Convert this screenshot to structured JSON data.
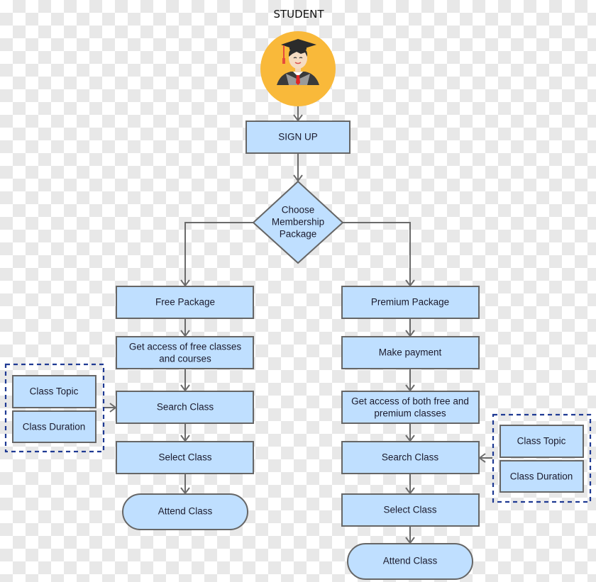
{
  "title": "STUDENT",
  "avatar": {
    "icon": "graduate-student-icon",
    "circle_color": "#F9B93A"
  },
  "colors": {
    "node_fill": "#BFDFFF",
    "node_border": "#666666",
    "edge": "#6B6B6B",
    "group_border": "#1F3A93"
  },
  "nodes": {
    "sign_up": "SIGN UP",
    "decision": [
      "Choose",
      "Membership",
      "Package"
    ],
    "free": {
      "package": "Free Package",
      "access": [
        "Get access of free classes",
        "and courses"
      ],
      "search": "Search Class",
      "select": "Select Class",
      "attend": "Attend Class",
      "filters": [
        "Class Topic",
        "Class Duration"
      ]
    },
    "premium": {
      "package": "Premium Package",
      "payment": "Make payment",
      "access": [
        "Get access of both free and",
        "premium classes"
      ],
      "search": "Search Class",
      "select": "Select Class",
      "attend": "Attend Class",
      "filters": [
        "Class Topic",
        "Class Duration"
      ]
    }
  }
}
